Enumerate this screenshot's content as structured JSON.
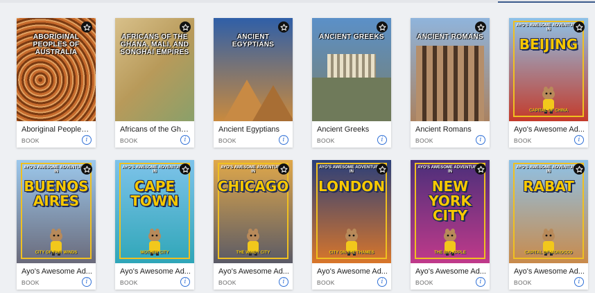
{
  "books": [
    {
      "title": "Aboriginal Peoples ...",
      "type": "BOOK",
      "cover_title": "ABORIGINAL PEOPLES OF AUSTRALIA",
      "cover_style": "aboriginal",
      "colors": [
        "#b35a23",
        "#7a3a12"
      ]
    },
    {
      "title": "Africans of the Gha...",
      "type": "BOOK",
      "cover_title": "AFRICANS OF THE GHANA, MALI, AND SONGHAI EMPIRES",
      "cover_style": "map",
      "colors": [
        "#c9b07a",
        "#6f8a4a"
      ]
    },
    {
      "title": "Ancient Egyptians",
      "type": "BOOK",
      "cover_title": "ANCIENT EGYPTIANS",
      "cover_style": "egypt",
      "colors": [
        "#2f5fa8",
        "#c98a3e"
      ]
    },
    {
      "title": "Ancient Greeks",
      "type": "BOOK",
      "cover_title": "ANCIENT GREEKS",
      "cover_style": "greece",
      "colors": [
        "#5b90c8",
        "#7a7f6a"
      ]
    },
    {
      "title": "Ancient Romans",
      "type": "BOOK",
      "cover_title": "ANCIENT ROMANS",
      "cover_style": "rome",
      "colors": [
        "#8fb4dc",
        "#a98262"
      ]
    },
    {
      "title": "Ayo's Awesome Ad...",
      "type": "BOOK",
      "cover_title": "BEIJING",
      "cover_series": "AYO'S AWESOME ADVENTURES IN",
      "cover_sub": "CAPITAL OF CHINA",
      "cover_style": "ayo",
      "colors": [
        "#8ec2e8",
        "#c43a2a"
      ]
    },
    {
      "title": "Ayo's Awesome Ad...",
      "type": "BOOK",
      "cover_title": "BUENOS AIRES",
      "cover_series": "AYO'S AWESOME ADVENTURES IN",
      "cover_sub": "CITY OF FAIR WINDS",
      "cover_style": "ayo",
      "colors": [
        "#9cc8ec",
        "#6a6a7a"
      ]
    },
    {
      "title": "Ayo's Awesome Ad...",
      "type": "BOOK",
      "cover_title": "CAPE TOWN",
      "cover_series": "AYO'S AWESOME ADVENTURES IN",
      "cover_sub": "MOTHER CITY",
      "cover_style": "ayo",
      "colors": [
        "#7ec3ea",
        "#2fa6b8"
      ]
    },
    {
      "title": "Ayo's Awesome Ad...",
      "type": "BOOK",
      "cover_title": "CHICAGO",
      "cover_series": "AYO'S AWESOME ADVENTURES IN",
      "cover_sub": "THE WINDY CITY",
      "cover_style": "ayo",
      "colors": [
        "#e0a84a",
        "#5a5a66"
      ]
    },
    {
      "title": "Ayo's Awesome Ad...",
      "type": "BOOK",
      "cover_title": "LONDON",
      "cover_series": "AYO'S AWESOME ADVENTURES IN",
      "cover_sub": "CITY ON THE THAMES",
      "cover_style": "ayo",
      "colors": [
        "#2a3f7a",
        "#d9762a"
      ]
    },
    {
      "title": "Ayo's Awesome Ad...",
      "type": "BOOK",
      "cover_title": "NEW YORK CITY",
      "cover_series": "AYO'S AWESOME ADVENTURES IN",
      "cover_sub": "THE BIG APPLE",
      "cover_style": "ayo",
      "colors": [
        "#4a2f7a",
        "#c13a8a"
      ]
    },
    {
      "title": "Ayo's Awesome Ad...",
      "type": "BOOK",
      "cover_title": "RABAT",
      "cover_series": "AYO'S AWESOME ADVENTURES IN",
      "cover_sub": "CAPITAL OF MOROCCO",
      "cover_style": "ayo",
      "colors": [
        "#8ec2e8",
        "#c98a4a"
      ]
    }
  ],
  "accent_color": "#2e6fd6",
  "favorite_icon": "star-outline-icon",
  "info_icon": "info-circle-icon"
}
